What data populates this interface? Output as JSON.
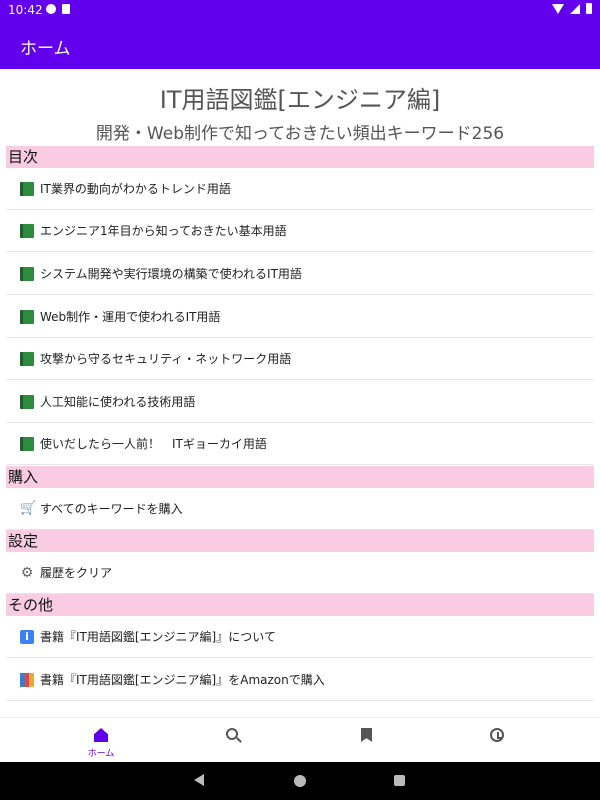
{
  "status_bar": {
    "time": "10:42"
  },
  "app_bar": {
    "title": "ホーム"
  },
  "book": {
    "title": "IT用語図鑑[エンジニア編]",
    "subtitle": "開発・Web制作で知っておきたい頻出キーワード256"
  },
  "sections": {
    "contents": {
      "header": "目次",
      "items": [
        {
          "label": "IT業界の動向がわかるトレンド用語",
          "icon": "green-book-icon"
        },
        {
          "label": "エンジニア1年目から知っておきたい基本用語",
          "icon": "green-book-icon"
        },
        {
          "label": "システム開発や実行環境の構築で使われるIT用語",
          "icon": "green-book-icon"
        },
        {
          "label": "Web制作・運用で使われるIT用語",
          "icon": "green-book-icon"
        },
        {
          "label": "攻撃から守るセキュリティ・ネットワーク用語",
          "icon": "green-book-icon"
        },
        {
          "label": "人工知能に使われる技術用語",
          "icon": "green-book-icon"
        },
        {
          "label": "使いだしたら一人前！　ITギョーカイ用語",
          "icon": "green-book-icon"
        }
      ]
    },
    "purchase": {
      "header": "購入",
      "items": [
        {
          "label": "すべてのキーワードを購入",
          "icon": "cart-icon"
        }
      ]
    },
    "settings": {
      "header": "設定",
      "items": [
        {
          "label": "履歴をクリア",
          "icon": "gear-icon"
        }
      ]
    },
    "other": {
      "header": "その他",
      "items": [
        {
          "label": "書籍『IT用語図鑑[エンジニア編]』について",
          "icon": "info-icon"
        },
        {
          "label": "書籍『IT用語図鑑[エンジニア編]』をAmazonで購入",
          "icon": "books-icon"
        }
      ]
    }
  },
  "bottom_nav": {
    "home_label": "ホーム",
    "items": [
      "home-icon",
      "search-icon",
      "bookmark-icon",
      "history-icon"
    ]
  },
  "colors": {
    "primary": "#6200ee",
    "section_header": "#f9cce3"
  }
}
